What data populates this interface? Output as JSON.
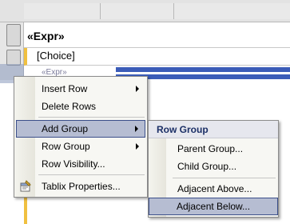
{
  "tablix": {
    "expr_header": "«Expr»",
    "choice_cell": "[Choice]",
    "expr_cell": "«Expr»"
  },
  "context_menu": {
    "items": [
      {
        "label": "Insert Row",
        "has_submenu": true
      },
      {
        "label": "Delete Rows",
        "has_submenu": false
      },
      {
        "label": "Add Group",
        "has_submenu": true,
        "highlighted": true
      },
      {
        "label": "Row Group",
        "has_submenu": true
      },
      {
        "label": "Row Visibility...",
        "has_submenu": false
      },
      {
        "label": "Tablix Properties...",
        "has_submenu": false,
        "icon": "properties-icon"
      }
    ]
  },
  "submenu": {
    "title": "Row Group",
    "items": [
      {
        "label": "Parent Group..."
      },
      {
        "label": "Child Group..."
      },
      {
        "label": "Adjacent Above..."
      },
      {
        "label": "Adjacent Below...",
        "highlighted": true
      }
    ]
  },
  "colors": {
    "highlight_bg": "#b6bdd2",
    "highlight_border": "#3b4f8a",
    "menu_bg": "#f7f7f3",
    "group_bar": "#3b5cb8",
    "row_group_marker": "#f0c040"
  }
}
